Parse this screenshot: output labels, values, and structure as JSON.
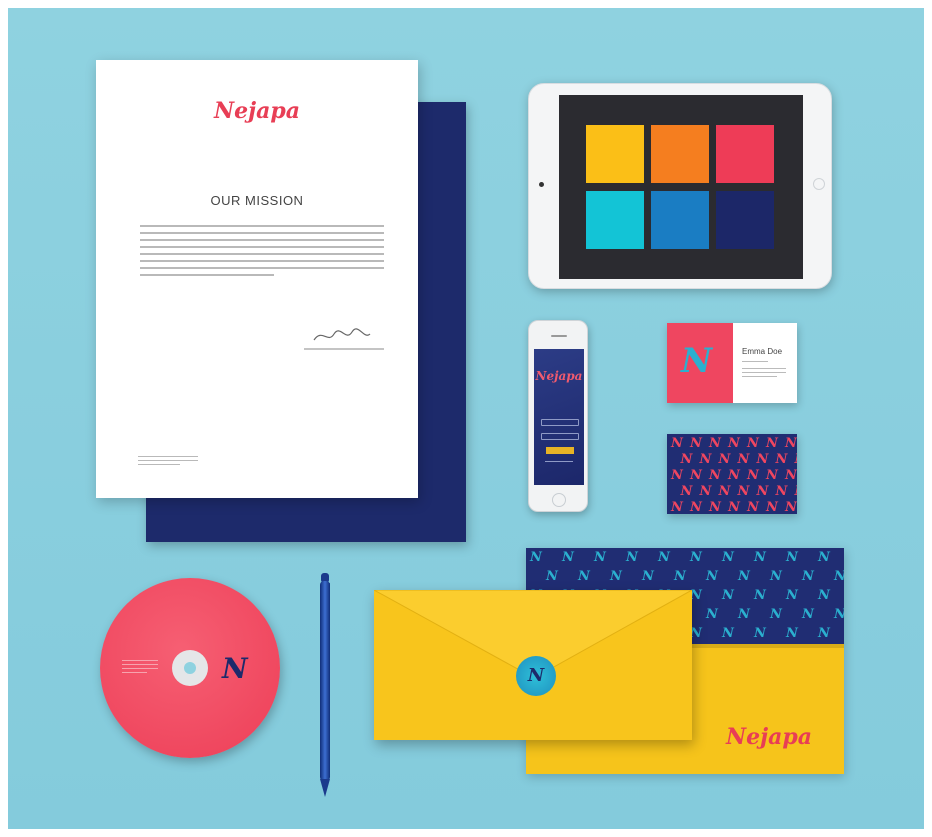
{
  "brand": {
    "name": "Nejapa",
    "monogram": "N",
    "colors": {
      "coral": "#ef4660",
      "navy": "#1d2a6b",
      "yellow": "#f8c51c",
      "cyan": "#2bb0cf",
      "orange": "#f5791e",
      "blue": "#1b7fc4"
    }
  },
  "letterhead": {
    "logo": "Nejapa",
    "heading": "OUR MISSION"
  },
  "tablet": {
    "swatches": [
      "#fbbf17",
      "#f57e1f",
      "#ee3c57",
      "#13c4d6",
      "#1a7dc3",
      "#1c2768"
    ]
  },
  "phone": {
    "logo": "Nejapa"
  },
  "business_card": {
    "name": "Emma Doe"
  },
  "envelope": {
    "logo": "Nejapa"
  },
  "objects": [
    {
      "name": "letterhead",
      "icon": "document-icon"
    },
    {
      "name": "tablet",
      "icon": "tablet-icon"
    },
    {
      "name": "smartphone",
      "icon": "phone-icon"
    },
    {
      "name": "business-cards",
      "icon": "card-icon"
    },
    {
      "name": "compact-disc",
      "icon": "disc-icon"
    },
    {
      "name": "pen",
      "icon": "pen-icon"
    },
    {
      "name": "envelopes",
      "icon": "envelope-icon"
    }
  ]
}
